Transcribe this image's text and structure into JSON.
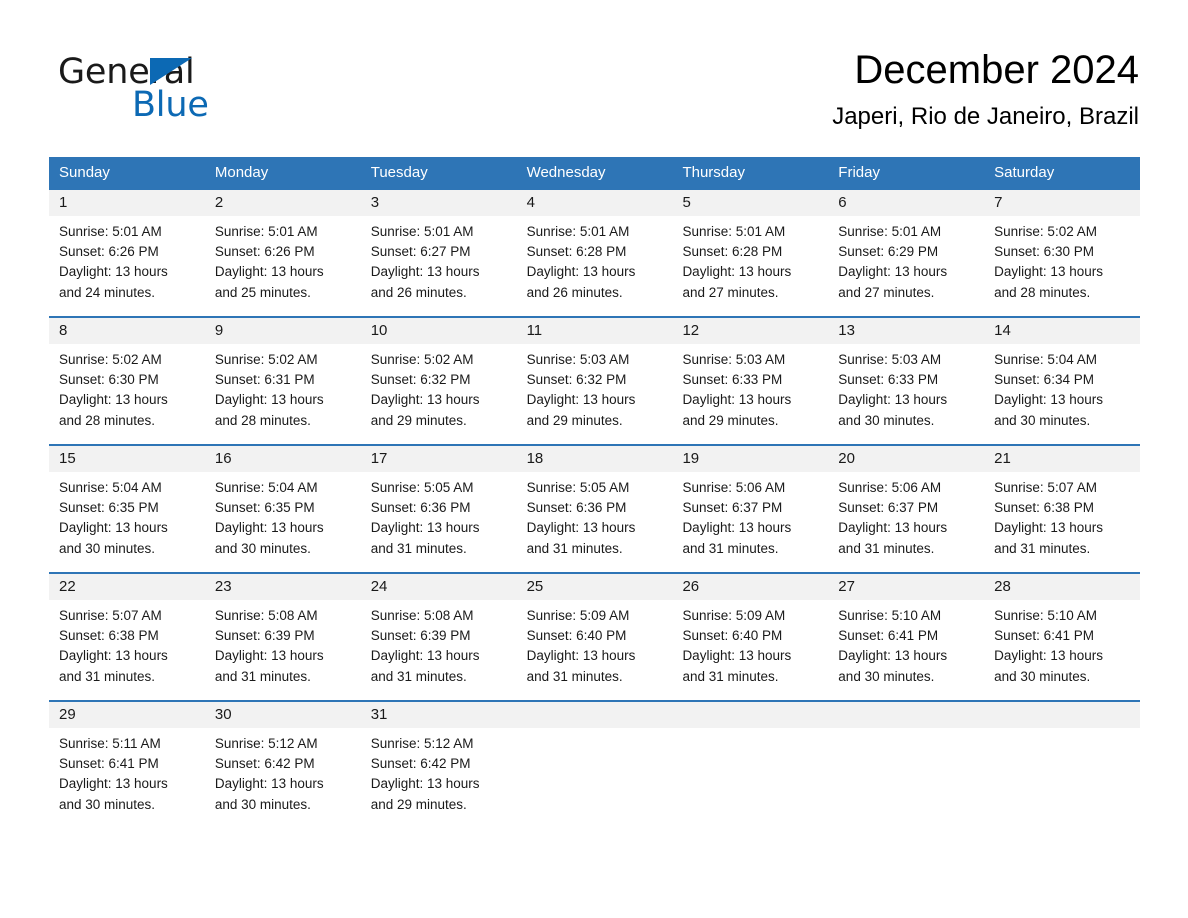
{
  "brand": {
    "name_part1": "General",
    "name_part2": "Blue",
    "accent_color": "#0c69b4"
  },
  "header": {
    "month_title": "December 2024",
    "location": "Japeri, Rio de Janeiro, Brazil"
  },
  "theme": {
    "header_blue": "#2e75b6",
    "day_band_gray": "#f2f2f2",
    "text_color": "#1a1a1a"
  },
  "weekdays": [
    "Sunday",
    "Monday",
    "Tuesday",
    "Wednesday",
    "Thursday",
    "Friday",
    "Saturday"
  ],
  "weeks": [
    [
      {
        "day": "1",
        "sunrise": "Sunrise: 5:01 AM",
        "sunset": "Sunset: 6:26 PM",
        "daylight_line1": "Daylight: 13 hours",
        "daylight_line2": "and 24 minutes."
      },
      {
        "day": "2",
        "sunrise": "Sunrise: 5:01 AM",
        "sunset": "Sunset: 6:26 PM",
        "daylight_line1": "Daylight: 13 hours",
        "daylight_line2": "and 25 minutes."
      },
      {
        "day": "3",
        "sunrise": "Sunrise: 5:01 AM",
        "sunset": "Sunset: 6:27 PM",
        "daylight_line1": "Daylight: 13 hours",
        "daylight_line2": "and 26 minutes."
      },
      {
        "day": "4",
        "sunrise": "Sunrise: 5:01 AM",
        "sunset": "Sunset: 6:28 PM",
        "daylight_line1": "Daylight: 13 hours",
        "daylight_line2": "and 26 minutes."
      },
      {
        "day": "5",
        "sunrise": "Sunrise: 5:01 AM",
        "sunset": "Sunset: 6:28 PM",
        "daylight_line1": "Daylight: 13 hours",
        "daylight_line2": "and 27 minutes."
      },
      {
        "day": "6",
        "sunrise": "Sunrise: 5:01 AM",
        "sunset": "Sunset: 6:29 PM",
        "daylight_line1": "Daylight: 13 hours",
        "daylight_line2": "and 27 minutes."
      },
      {
        "day": "7",
        "sunrise": "Sunrise: 5:02 AM",
        "sunset": "Sunset: 6:30 PM",
        "daylight_line1": "Daylight: 13 hours",
        "daylight_line2": "and 28 minutes."
      }
    ],
    [
      {
        "day": "8",
        "sunrise": "Sunrise: 5:02 AM",
        "sunset": "Sunset: 6:30 PM",
        "daylight_line1": "Daylight: 13 hours",
        "daylight_line2": "and 28 minutes."
      },
      {
        "day": "9",
        "sunrise": "Sunrise: 5:02 AM",
        "sunset": "Sunset: 6:31 PM",
        "daylight_line1": "Daylight: 13 hours",
        "daylight_line2": "and 28 minutes."
      },
      {
        "day": "10",
        "sunrise": "Sunrise: 5:02 AM",
        "sunset": "Sunset: 6:32 PM",
        "daylight_line1": "Daylight: 13 hours",
        "daylight_line2": "and 29 minutes."
      },
      {
        "day": "11",
        "sunrise": "Sunrise: 5:03 AM",
        "sunset": "Sunset: 6:32 PM",
        "daylight_line1": "Daylight: 13 hours",
        "daylight_line2": "and 29 minutes."
      },
      {
        "day": "12",
        "sunrise": "Sunrise: 5:03 AM",
        "sunset": "Sunset: 6:33 PM",
        "daylight_line1": "Daylight: 13 hours",
        "daylight_line2": "and 29 minutes."
      },
      {
        "day": "13",
        "sunrise": "Sunrise: 5:03 AM",
        "sunset": "Sunset: 6:33 PM",
        "daylight_line1": "Daylight: 13 hours",
        "daylight_line2": "and 30 minutes."
      },
      {
        "day": "14",
        "sunrise": "Sunrise: 5:04 AM",
        "sunset": "Sunset: 6:34 PM",
        "daylight_line1": "Daylight: 13 hours",
        "daylight_line2": "and 30 minutes."
      }
    ],
    [
      {
        "day": "15",
        "sunrise": "Sunrise: 5:04 AM",
        "sunset": "Sunset: 6:35 PM",
        "daylight_line1": "Daylight: 13 hours",
        "daylight_line2": "and 30 minutes."
      },
      {
        "day": "16",
        "sunrise": "Sunrise: 5:04 AM",
        "sunset": "Sunset: 6:35 PM",
        "daylight_line1": "Daylight: 13 hours",
        "daylight_line2": "and 30 minutes."
      },
      {
        "day": "17",
        "sunrise": "Sunrise: 5:05 AM",
        "sunset": "Sunset: 6:36 PM",
        "daylight_line1": "Daylight: 13 hours",
        "daylight_line2": "and 31 minutes."
      },
      {
        "day": "18",
        "sunrise": "Sunrise: 5:05 AM",
        "sunset": "Sunset: 6:36 PM",
        "daylight_line1": "Daylight: 13 hours",
        "daylight_line2": "and 31 minutes."
      },
      {
        "day": "19",
        "sunrise": "Sunrise: 5:06 AM",
        "sunset": "Sunset: 6:37 PM",
        "daylight_line1": "Daylight: 13 hours",
        "daylight_line2": "and 31 minutes."
      },
      {
        "day": "20",
        "sunrise": "Sunrise: 5:06 AM",
        "sunset": "Sunset: 6:37 PM",
        "daylight_line1": "Daylight: 13 hours",
        "daylight_line2": "and 31 minutes."
      },
      {
        "day": "21",
        "sunrise": "Sunrise: 5:07 AM",
        "sunset": "Sunset: 6:38 PM",
        "daylight_line1": "Daylight: 13 hours",
        "daylight_line2": "and 31 minutes."
      }
    ],
    [
      {
        "day": "22",
        "sunrise": "Sunrise: 5:07 AM",
        "sunset": "Sunset: 6:38 PM",
        "daylight_line1": "Daylight: 13 hours",
        "daylight_line2": "and 31 minutes."
      },
      {
        "day": "23",
        "sunrise": "Sunrise: 5:08 AM",
        "sunset": "Sunset: 6:39 PM",
        "daylight_line1": "Daylight: 13 hours",
        "daylight_line2": "and 31 minutes."
      },
      {
        "day": "24",
        "sunrise": "Sunrise: 5:08 AM",
        "sunset": "Sunset: 6:39 PM",
        "daylight_line1": "Daylight: 13 hours",
        "daylight_line2": "and 31 minutes."
      },
      {
        "day": "25",
        "sunrise": "Sunrise: 5:09 AM",
        "sunset": "Sunset: 6:40 PM",
        "daylight_line1": "Daylight: 13 hours",
        "daylight_line2": "and 31 minutes."
      },
      {
        "day": "26",
        "sunrise": "Sunrise: 5:09 AM",
        "sunset": "Sunset: 6:40 PM",
        "daylight_line1": "Daylight: 13 hours",
        "daylight_line2": "and 31 minutes."
      },
      {
        "day": "27",
        "sunrise": "Sunrise: 5:10 AM",
        "sunset": "Sunset: 6:41 PM",
        "daylight_line1": "Daylight: 13 hours",
        "daylight_line2": "and 30 minutes."
      },
      {
        "day": "28",
        "sunrise": "Sunrise: 5:10 AM",
        "sunset": "Sunset: 6:41 PM",
        "daylight_line1": "Daylight: 13 hours",
        "daylight_line2": "and 30 minutes."
      }
    ],
    [
      {
        "day": "29",
        "sunrise": "Sunrise: 5:11 AM",
        "sunset": "Sunset: 6:41 PM",
        "daylight_line1": "Daylight: 13 hours",
        "daylight_line2": "and 30 minutes."
      },
      {
        "day": "30",
        "sunrise": "Sunrise: 5:12 AM",
        "sunset": "Sunset: 6:42 PM",
        "daylight_line1": "Daylight: 13 hours",
        "daylight_line2": "and 30 minutes."
      },
      {
        "day": "31",
        "sunrise": "Sunrise: 5:12 AM",
        "sunset": "Sunset: 6:42 PM",
        "daylight_line1": "Daylight: 13 hours",
        "daylight_line2": "and 29 minutes."
      },
      {
        "day": "",
        "sunrise": "",
        "sunset": "",
        "daylight_line1": "",
        "daylight_line2": ""
      },
      {
        "day": "",
        "sunrise": "",
        "sunset": "",
        "daylight_line1": "",
        "daylight_line2": ""
      },
      {
        "day": "",
        "sunrise": "",
        "sunset": "",
        "daylight_line1": "",
        "daylight_line2": ""
      },
      {
        "day": "",
        "sunrise": "",
        "sunset": "",
        "daylight_line1": "",
        "daylight_line2": ""
      }
    ]
  ]
}
